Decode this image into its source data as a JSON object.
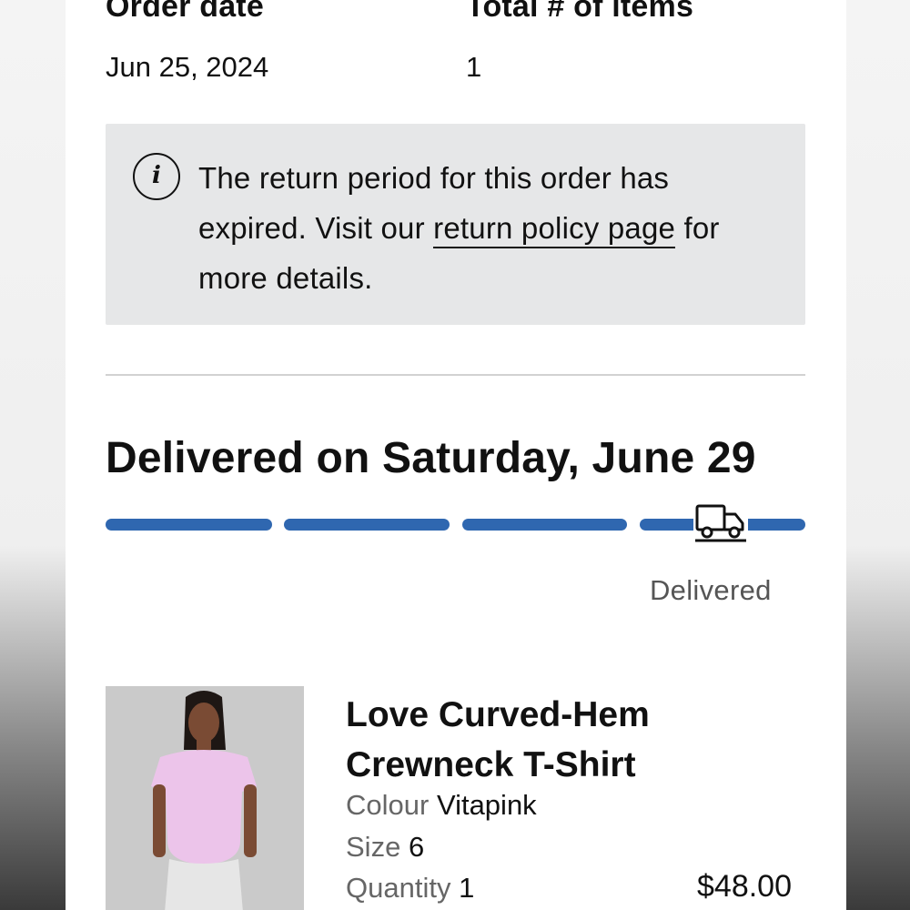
{
  "order_summary": {
    "order_date_label": "Order date",
    "order_date_value": "Jun 25, 2024",
    "items_label": "Total # of items",
    "items_value": "1"
  },
  "return_notice": {
    "icon": "info-icon",
    "text_before": "The return period for this order has expired. Visit our ",
    "link_text": "return policy page",
    "text_after": " for more details."
  },
  "delivery": {
    "title": "Delivered on Saturday, June 29",
    "progress_steps_completed": 4,
    "progress_steps_total": 4,
    "progress_color": "#2f67b0",
    "status_icon": "truck-icon",
    "status_label": "Delivered"
  },
  "product": {
    "name": "Love Curved-Hem Crewneck T-Shirt",
    "colour_label": "Colour",
    "colour_value": "Vitapink",
    "size_label": "Size",
    "size_value": "6",
    "quantity_label": "Quantity",
    "quantity_value": "1",
    "price": "$48.00"
  }
}
